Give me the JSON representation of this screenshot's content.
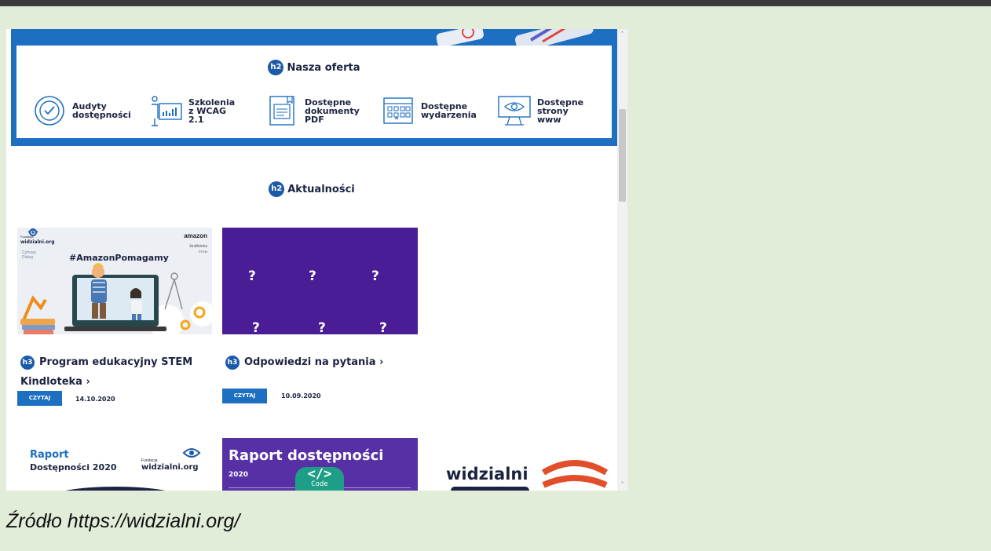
{
  "offer": {
    "heading_badge": "h2",
    "heading": "Nasza oferta",
    "items": [
      {
        "label": "Audyty\ndostępności",
        "icon": "checkmark-circle-icon"
      },
      {
        "label": "Szkolenia\nz WCAG\n2.1",
        "icon": "presentation-board-icon"
      },
      {
        "label": "Dostępne\ndokumenty\nPDF",
        "icon": "document-icon"
      },
      {
        "label": "Dostępne\nwydarzenia",
        "icon": "calendar-icon"
      },
      {
        "label": "Dostępne\nstrony\nwww",
        "icon": "monitor-eye-icon"
      }
    ]
  },
  "news": {
    "heading_badge": "h2",
    "heading": "Aktualności",
    "cards": [
      {
        "badge": "h3",
        "title": "Program edukacyjny STEM Kindloteka",
        "arrow": "›",
        "button": "CZYTAJ",
        "date": "14.10.2020",
        "image": {
          "logo_small": "Fundacja",
          "logo": "widzialni.org",
          "logo2_top": "Cyfrowy",
          "logo2_bottom": "Dialog",
          "brand": "amazon",
          "brand_sub": "kindloteka",
          "brand_sub2": "STEM",
          "hashtag": "#AmazonPomagamy"
        }
      },
      {
        "badge": "h3",
        "title": "Odpowiedzi na pytania",
        "arrow": "›",
        "button": "CZYTAJ",
        "date": "10.09.2020",
        "image": {
          "marks": [
            "?",
            "?",
            "?",
            "?",
            "?",
            "?"
          ]
        }
      }
    ]
  },
  "reports": [
    {
      "title_line1": "Raport",
      "title_line2": "Dostępności 2020",
      "org_small": "Fundacja",
      "org": "widzialni.org"
    },
    {
      "title": "Raport dostępności",
      "year": "2020"
    },
    {
      "brand": "widzialni"
    }
  ],
  "code_badge": {
    "glyph": "</>",
    "label": "Code"
  },
  "caption": "Źródło https://widzialni.org/",
  "scrollbar": {
    "up": "˄",
    "down": "˅"
  },
  "colors": {
    "accent": "#1d6fc1",
    "navy": "#1c2340",
    "purple": "#4a1d96",
    "teal": "#1e9e86",
    "page_bg": "#e2edd9"
  }
}
